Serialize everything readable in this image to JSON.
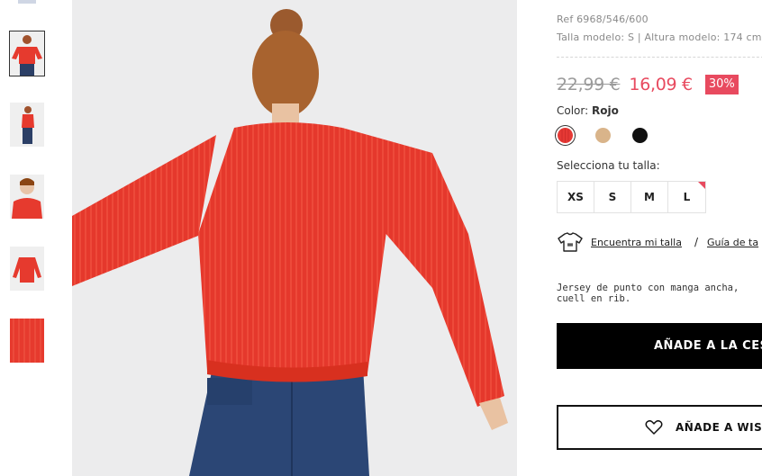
{
  "product": {
    "ref": "Ref 6968/546/600",
    "model_info": "Talla modelo: S | Altura modelo: 174 cm",
    "old_price": "22,99 €",
    "new_price": "16,09 €",
    "discount": "30%",
    "color_label": "Color:",
    "color_value": "Rojo",
    "colors": [
      {
        "name": "red",
        "hex": "#e53935",
        "selected": true
      },
      {
        "name": "beige",
        "hex": "#d9b48a",
        "selected": false
      },
      {
        "name": "black",
        "hex": "#111111",
        "selected": false
      }
    ],
    "size_label": "Selecciona tu talla:",
    "sizes": [
      "XS",
      "S",
      "M",
      "L"
    ],
    "find_size_link": "Encuentra mi talla",
    "separator": "/",
    "size_guide_link": "Guía de ta",
    "description": "Jersey de punto con manga ancha, cuell en rib.",
    "add_to_cart": "AÑADE A LA CES",
    "add_to_wishlist": "AÑADE A WISHL"
  },
  "icons": {
    "tshirt": "tshirt-icon",
    "heart": "heart-icon"
  },
  "theme": {
    "sale_color": "#e84a5f",
    "sweater_color": "#e63a2e"
  }
}
